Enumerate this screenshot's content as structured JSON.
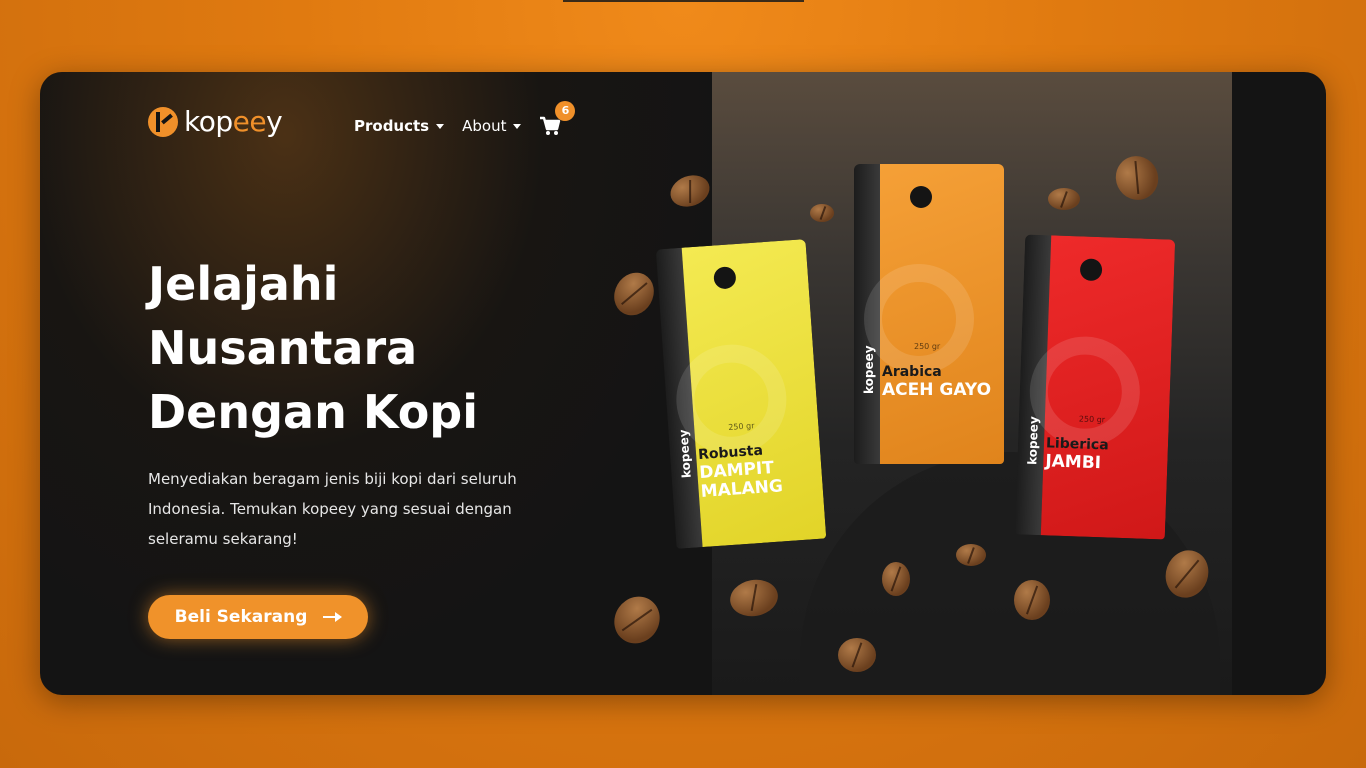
{
  "brand": {
    "name_part1": "kop",
    "name_accent": "ee",
    "name_part2": "y",
    "logo_icon": "kopeey-logo-icon"
  },
  "nav": {
    "items": [
      {
        "label": "Products",
        "icon": "chevron-down-icon"
      },
      {
        "label": "About",
        "icon": "chevron-down-icon"
      }
    ],
    "cart": {
      "icon": "cart-icon",
      "count": "6"
    }
  },
  "hero": {
    "title_lines": [
      "Jelajahi",
      "Nusantara",
      "Dengan Kopi"
    ],
    "description": "Menyediakan beragam jenis biji kopi dari seluruh Indonesia. Temukan kopeey yang sesuai dengan seleramu sekarang!",
    "cta_label": "Beli Sekarang",
    "cta_icon": "arrow-right-icon"
  },
  "products": [
    {
      "variety": "Robusta",
      "origin": "DAMPIT MALANG",
      "weight": "250 gr",
      "brand": "kopeey",
      "color": "#e8dc34"
    },
    {
      "variety": "Arabica",
      "origin": "ACEH GAYO",
      "weight": "250 gr",
      "brand": "kopeey",
      "color": "#ee8f26"
    },
    {
      "variety": "Liberica",
      "origin": "JAMBI",
      "weight": "250 gr",
      "brand": "kopeey",
      "color": "#e02020"
    }
  ],
  "colors": {
    "accent": "#f0902a",
    "card_background": "#141414",
    "page_background": "#e07a10"
  }
}
